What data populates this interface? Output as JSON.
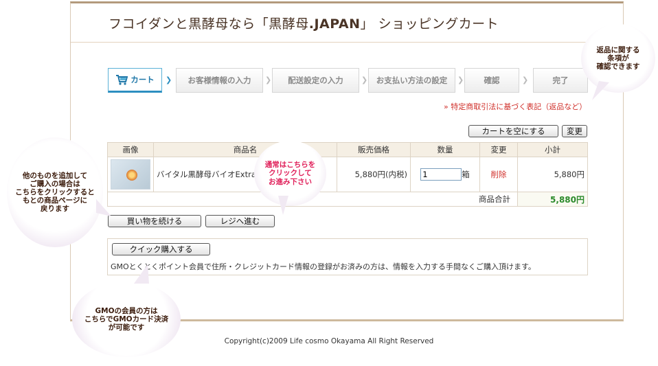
{
  "header": {
    "title_prefix": "フコイダンと黒酵母なら「黒酵母",
    "title_brand": ".JAPAN",
    "title_suffix": "」 ショッピングカート"
  },
  "steps": [
    {
      "label": "カート",
      "active": true
    },
    {
      "label": "お客様情報の入力"
    },
    {
      "label": "配送設定の入力"
    },
    {
      "label": "お支払い方法の設定"
    },
    {
      "label": "確認"
    },
    {
      "label": "完了"
    }
  ],
  "legal_link": "» 特定商取引法に基づく表記（返品など）",
  "cart_actions": {
    "empty_cart": "カートを空にする",
    "update": "変更"
  },
  "table": {
    "headers": [
      "画像",
      "商品名",
      "販売価格",
      "数量",
      "変更",
      "小計"
    ],
    "rows": [
      {
        "name": "バイタル黒酵母バイオExtra",
        "price": "5,880円(内税)",
        "qty": "1",
        "unit": "箱",
        "delete": "削除",
        "subtotal": "5,880円"
      }
    ],
    "total_label": "商品合計",
    "total_value": "5,880円"
  },
  "buttons": {
    "continue": "買い物を続ける",
    "checkout": "レジへ進む",
    "quick": "クイック購入する"
  },
  "quick_note": "GMOとくとくポイント会員で住所・クレジットカード情報の登録がお済みの方は、情報を入力する手間なくご購入頂けます。",
  "callouts": {
    "left": "他のものを追加して\nご購入の場合は\nこちらをクリックすると\nもとの商品ページに\n戻ります",
    "center": "通常はこちらを\nクリックして\nお進み下さい",
    "top_right": "返品に関する\n条項が\n確認できます",
    "bottom": "GMOの会員の方は\nこちらでGMOカード決済\nが可能です"
  },
  "copyright": "Copyright(c)2009 Life cosmo Okayama All Right Reserved",
  "colors": {
    "accent": "#2d8fc0",
    "link_red": "#d0302b",
    "total_green": "#2b8a2b",
    "header_bg": "#f5efe4"
  }
}
